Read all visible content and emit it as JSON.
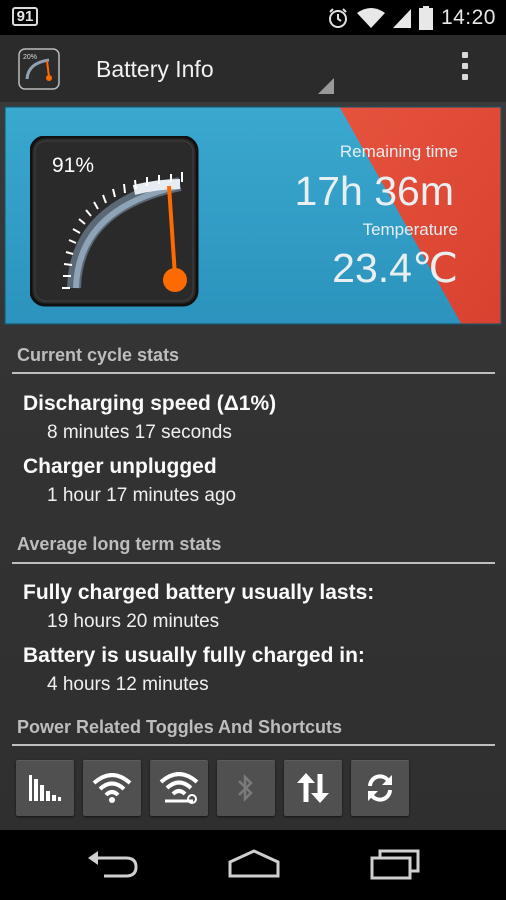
{
  "status_bar": {
    "badge": "91",
    "time": "14:20",
    "icons": [
      "alarm-icon",
      "wifi-icon",
      "cell-signal-icon",
      "battery-icon"
    ]
  },
  "action_bar": {
    "title": "Battery Info",
    "app_icon_text": "20%",
    "icons": [
      "app-gauge-icon",
      "overflow-menu-icon"
    ]
  },
  "banner": {
    "gauge_percent": "91%",
    "gauge_level": 0.91,
    "remaining_label": "Remaining time",
    "remaining_value": "17h 36m",
    "temperature_label": "Temperature",
    "temperature_value": "23.4℃",
    "colors": {
      "blue": "#2e9ec6",
      "red": "#e04a36",
      "needle": "#ff6a00"
    }
  },
  "current_cycle": {
    "header": "Current cycle stats",
    "items": [
      {
        "title": "Discharging speed (Δ1%)",
        "value": "8 minutes 17 seconds"
      },
      {
        "title": "Charger unplugged",
        "value": "1 hour 17 minutes ago"
      }
    ]
  },
  "long_term": {
    "header": "Average long term stats",
    "items": [
      {
        "title": "Fully charged battery usually lasts:",
        "value": "19 hours 20 minutes"
      },
      {
        "title": "Battery is usually fully charged in:",
        "value": "4 hours 12 minutes"
      }
    ]
  },
  "toggles": {
    "header": "Power Related Toggles And Shortcuts",
    "icons": [
      "usage-chart-icon",
      "wifi-icon",
      "wifi-settings-icon",
      "bluetooth-icon",
      "data-sync-arrows-icon",
      "refresh-icon"
    ]
  },
  "nav_bar": {
    "icons": [
      "back-icon",
      "home-icon",
      "recents-icon"
    ]
  }
}
